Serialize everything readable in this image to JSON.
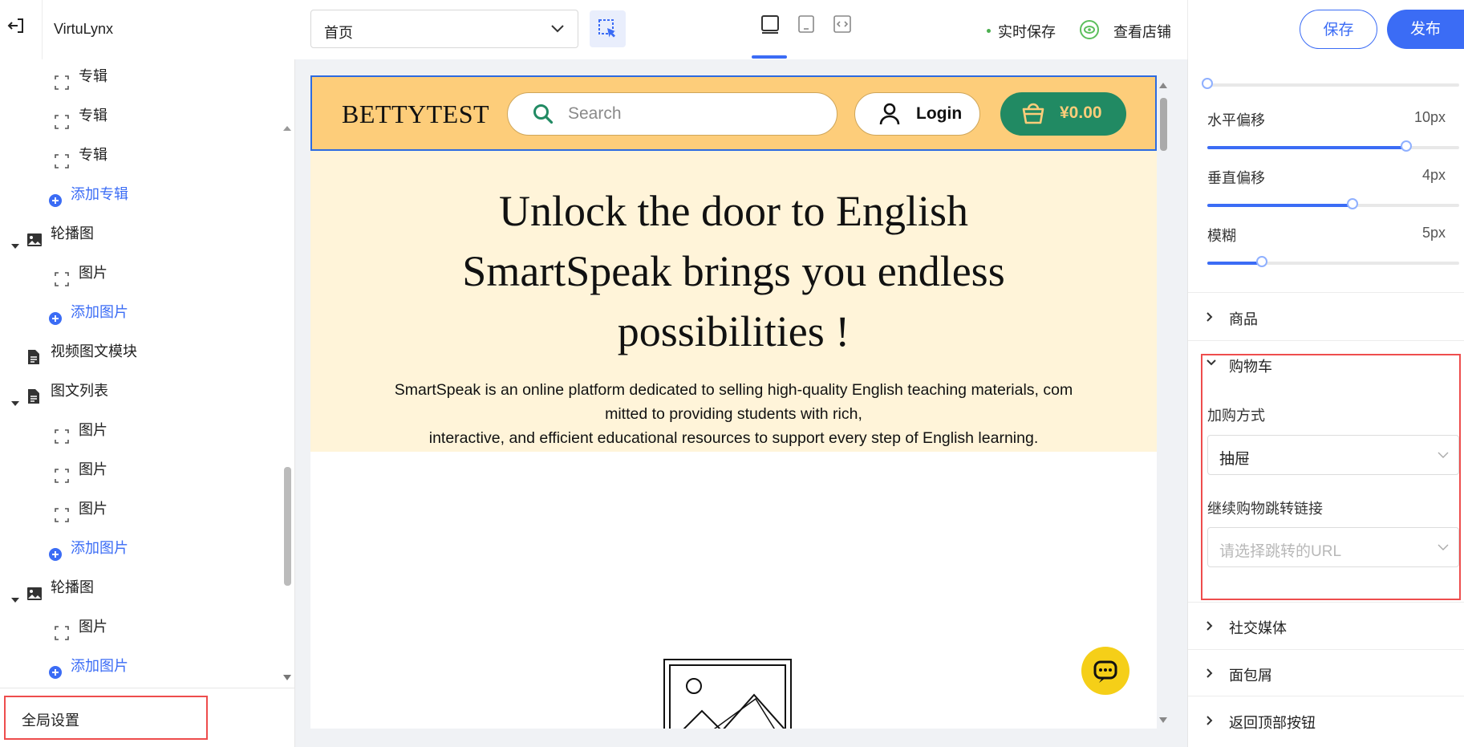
{
  "app": {
    "name": "VirtuLynx"
  },
  "toolbar": {
    "page_select_value": "首页",
    "realtime_save": "实时保存",
    "view_store": "查看店铺",
    "save": "保存",
    "publish": "发布"
  },
  "tree": {
    "rows": [
      {
        "label": "专辑",
        "kind": "leaf"
      },
      {
        "label": "专辑",
        "kind": "leaf"
      },
      {
        "label": "专辑",
        "kind": "leaf"
      },
      {
        "label": "添加专辑",
        "kind": "add"
      },
      {
        "label": "轮播图",
        "kind": "group-carousel"
      },
      {
        "label": "图片",
        "kind": "leaf"
      },
      {
        "label": "添加图片",
        "kind": "add"
      },
      {
        "label": "视频图文模块",
        "kind": "doc"
      },
      {
        "label": "图文列表",
        "kind": "group-doc"
      },
      {
        "label": "图片",
        "kind": "leaf"
      },
      {
        "label": "图片",
        "kind": "leaf"
      },
      {
        "label": "图片",
        "kind": "leaf"
      },
      {
        "label": "添加图片",
        "kind": "add"
      },
      {
        "label": "轮播图",
        "kind": "group-carousel"
      },
      {
        "label": "图片",
        "kind": "leaf"
      },
      {
        "label": "添加图片",
        "kind": "add"
      }
    ],
    "global_settings": "全局设置"
  },
  "site": {
    "brand": "BETTYTEST",
    "search_placeholder": "Search",
    "login": "Login",
    "cart_total": "¥0.00",
    "hero_title_lines": [
      "Unlock the door to English",
      "SmartSpeak brings you endless",
      "possibilities !"
    ],
    "hero_desc_lines": [
      "SmartSpeak is an online platform dedicated to selling high-quality English teaching materials, com",
      "mitted to providing students with rich,",
      "interactive, and efficient educational resources to support every step of English learning."
    ]
  },
  "settings": {
    "sliders": [
      {
        "label": "水平偏移",
        "value_text": "10px",
        "fraction": 0.79
      },
      {
        "label": "垂直偏移",
        "value_text": "4px",
        "fraction": 0.575
      },
      {
        "label": "模糊",
        "value_text": "5px",
        "fraction": 0.215
      }
    ],
    "top_slider_fraction": 0,
    "sections": {
      "product": "商品",
      "cart": "购物车",
      "social": "社交媒体",
      "breadcrumb": "面包屑",
      "back_to_top": "返回顶部按钮"
    },
    "cart": {
      "add_mode_label": "加购方式",
      "add_mode_value": "抽屉",
      "continue_label": "继续购物跳转链接",
      "continue_placeholder": "请选择跳转的URL"
    }
  },
  "colors": {
    "accent": "#3b6cf5",
    "header_bg": "#fdcd7a",
    "hero_bg": "#fff4d9",
    "cart_green": "#218a63",
    "highlight_red": "#ee4d4d"
  }
}
